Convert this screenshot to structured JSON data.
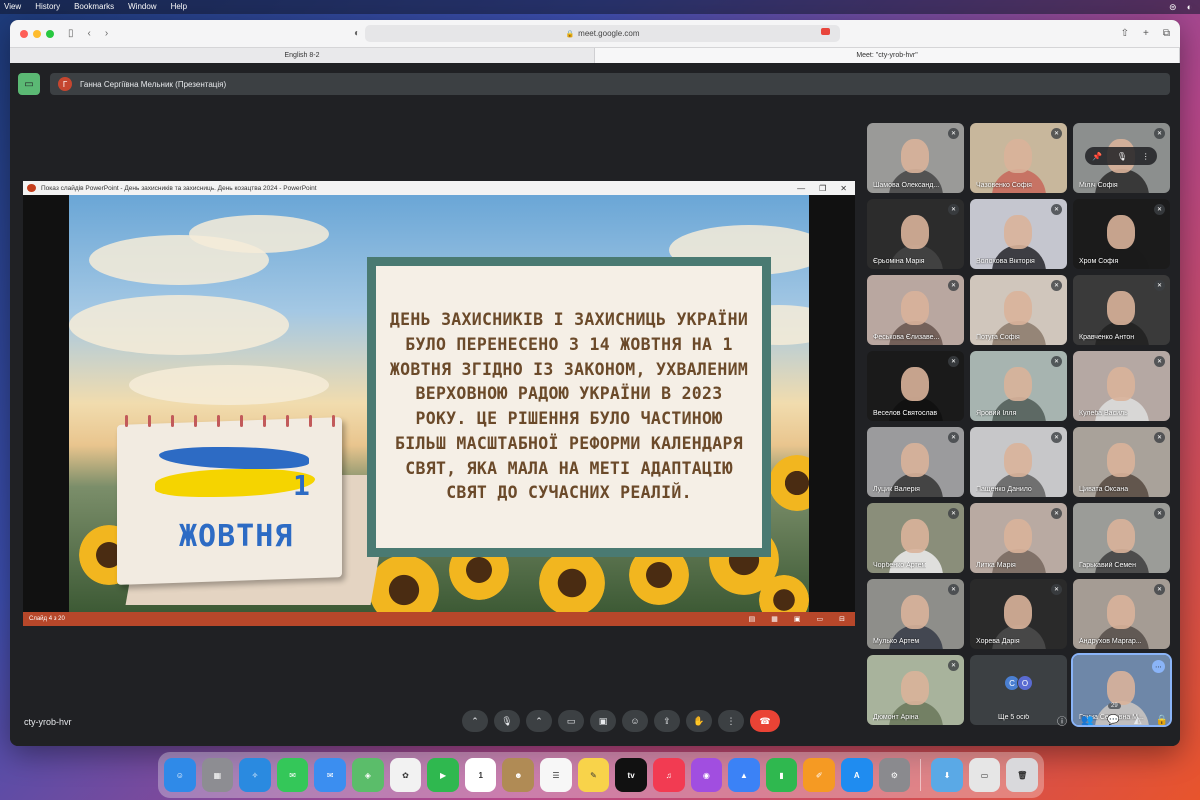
{
  "menubar": {
    "items": [
      "View",
      "History",
      "Bookmarks",
      "Window",
      "Help"
    ]
  },
  "browser": {
    "url": "meet.google.com",
    "tabs": [
      {
        "label": "English 8-2",
        "active": false
      },
      {
        "label": "Meet: \"cty-yrob-hvr\"",
        "active": true
      }
    ]
  },
  "meet": {
    "presenter_initial": "Г",
    "presenter_label": "Ганна Сергіївна Мельник (Презентація)",
    "meeting_code": "cty-yrob-hvr",
    "participant_badge": "29",
    "more_count_label": "Ще 5 осіб",
    "more_avatars": [
      "С",
      "О"
    ]
  },
  "ppt": {
    "window_title": "Показ слайдів PowerPoint  -  День захисників та захисниць. День козацтва 2024  -  PowerPoint",
    "status": "Слайд 4 з 20"
  },
  "slide": {
    "text": "ДЕНЬ ЗАХИСНИКІВ І ЗАХИСНИЦЬ УКРАЇНИ БУЛО ПЕРЕНЕСЕНО З 14 ЖОВТНЯ НА 1 ЖОВТНЯ ЗГІДНО ІЗ ЗАКОНОМ, УХВАЛЕНИМ ВЕРХОВНОЮ РАДОЮ УКРАЇНИ В 2023 РОКУ. ЦЕ РІШЕННЯ БУЛО ЧАСТИНОЮ БІЛЬШ МАСШТАБНОЇ РЕФОРМИ КАЛЕНДАРЯ СВЯТ, ЯКА МАЛА НА МЕТІ АДАПТАЦІЮ СВЯТ ДО СУЧАСНИХ РЕАЛІЙ.",
    "calendar_day": "1",
    "calendar_month": "ЖОВТНЯ"
  },
  "participants": [
    {
      "name": "Шамова Олександ...",
      "bg": "#9a9a98",
      "shirt": "#4a4a4a"
    },
    {
      "name": "Чазовенко Софія",
      "bg": "#c8b79c",
      "shirt": "#c76b5e"
    },
    {
      "name": "Міліч Софія",
      "bg": "#8c8f8e",
      "shirt": "#303030"
    },
    {
      "name": "Єрьоміна Марія",
      "bg": "#2c2c2c",
      "shirt": "#444"
    },
    {
      "name": "Волохова Вікторія",
      "bg": "#c5c6cf",
      "shirt": "#2e2e33"
    },
    {
      "name": "Хром Софія",
      "bg": "#1b1b1b",
      "shirt": "#1b1b1b"
    },
    {
      "name": "Феськова Єлизаве...",
      "bg": "#b9a7a0",
      "shirt": "#6d5a52"
    },
    {
      "name": "Потуга Софія",
      "bg": "#d0c6bc",
      "shirt": "#8e7d6f"
    },
    {
      "name": "Кравченко Антон",
      "bg": "#3a3a3a",
      "shirt": "#222"
    },
    {
      "name": "Веселов Святослав",
      "bg": "#1a1a1a",
      "shirt": "#111"
    },
    {
      "name": "Яровий Ілля",
      "bg": "#a7b4b0",
      "shirt": "#55605c"
    },
    {
      "name": "Кулеба Василь",
      "bg": "#b5a8a3",
      "shirt": "#dcdcdc"
    },
    {
      "name": "Луцик Валерія",
      "bg": "#9b9b9d",
      "shirt": "#3b3b3b"
    },
    {
      "name": "Пащенко Данило",
      "bg": "#c7c7c9",
      "shirt": "#666"
    },
    {
      "name": "Цивата Оксана",
      "bg": "#a9a29a",
      "shirt": "#5a4e45"
    },
    {
      "name": "Чорбенко Артем",
      "bg": "#8a8e7a",
      "shirt": "#e8e8e8"
    },
    {
      "name": "Литка Марія",
      "bg": "#b9aaa2",
      "shirt": "#7a6a62"
    },
    {
      "name": "Гарькавий Семен",
      "bg": "#9b9c98",
      "shirt": "#444"
    },
    {
      "name": "Мулько Артем",
      "bg": "#8e8e8a",
      "shirt": "#3b3f4a"
    },
    {
      "name": "Хорева Дарія",
      "bg": "#2a2a2a",
      "shirt": "#4a4a4a"
    },
    {
      "name": "Андрухов Маргар...",
      "bg": "#a59c94",
      "shirt": "#5a524c"
    },
    {
      "name": "Дюмонт Аріна",
      "bg": "#a8b39c",
      "shirt": "#6d7a5e"
    },
    {
      "name": "Ганна Сергіївна М...",
      "bg": "#6e87a8",
      "shirt": "#c9c4c0"
    }
  ],
  "dock": {
    "apps": [
      {
        "name": "finder",
        "color": "#2f8ae8",
        "glyph": "☺"
      },
      {
        "name": "launchpad",
        "color": "#8d8d92",
        "glyph": "▦"
      },
      {
        "name": "safari",
        "color": "#2a8ae0",
        "glyph": "✧"
      },
      {
        "name": "messages",
        "color": "#34c759",
        "glyph": "✉"
      },
      {
        "name": "mail",
        "color": "#3b8ef0",
        "glyph": "✉"
      },
      {
        "name": "maps",
        "color": "#5bbd6a",
        "glyph": "◈"
      },
      {
        "name": "photos",
        "color": "#f2f2f2",
        "glyph": "✿"
      },
      {
        "name": "facetime",
        "color": "#2fb84f",
        "glyph": "▶"
      },
      {
        "name": "calendar",
        "color": "#ffffff",
        "glyph": "1"
      },
      {
        "name": "contacts",
        "color": "#b08b55",
        "glyph": "☻"
      },
      {
        "name": "reminders",
        "color": "#f7f7f7",
        "glyph": "☰"
      },
      {
        "name": "notes",
        "color": "#f8d34a",
        "glyph": "✎"
      },
      {
        "name": "tv",
        "color": "#111111",
        "glyph": "tv"
      },
      {
        "name": "music",
        "color": "#f23b52",
        "glyph": "♫"
      },
      {
        "name": "podcasts",
        "color": "#a14ee0",
        "glyph": "◉"
      },
      {
        "name": "keynote",
        "color": "#3b82f6",
        "glyph": "▲"
      },
      {
        "name": "numbers",
        "color": "#2fb84f",
        "glyph": "▮"
      },
      {
        "name": "pages",
        "color": "#f59a23",
        "glyph": "✐"
      },
      {
        "name": "app-store",
        "color": "#1f8cf0",
        "glyph": "A"
      },
      {
        "name": "system-preferences",
        "color": "#8a8a8e",
        "glyph": "⚙"
      }
    ],
    "extras": [
      {
        "name": "downloads",
        "color": "#5aa9e6",
        "glyph": "⬇"
      },
      {
        "name": "preview",
        "color": "#e6e6e6",
        "glyph": "▭"
      },
      {
        "name": "trash",
        "color": "#d9d9dc",
        "glyph": "🗑"
      }
    ]
  }
}
